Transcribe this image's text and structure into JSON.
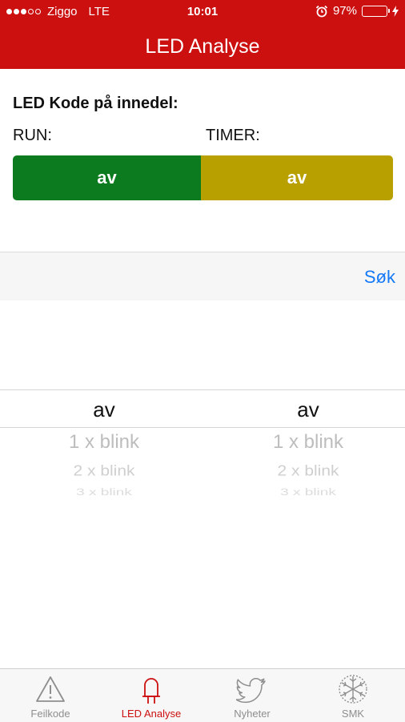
{
  "status_bar": {
    "carrier": "Ziggo",
    "network": "LTE",
    "time": "10:01",
    "battery_text": "97%",
    "battery_level": 0.97,
    "signal_bars_filled": 3,
    "signal_bars_total": 5,
    "icons": [
      "signal-dots-icon",
      "alarm-icon",
      "battery-icon",
      "charging-bolt-icon"
    ]
  },
  "nav": {
    "title": "LED Analyse"
  },
  "led": {
    "heading": "LED Kode på innedel:",
    "run_label": "RUN:",
    "timer_label": "TIMER:",
    "run_value": "av",
    "timer_value": "av",
    "run_color": "#0c7a1e",
    "timer_color": "#b8a000"
  },
  "search": {
    "button_label": "Søk"
  },
  "picker": {
    "left": {
      "selected": "av",
      "options": [
        "1 x blink",
        "2 x blink",
        "3 x blink"
      ]
    },
    "right": {
      "selected": "av",
      "options": [
        "1 x blink",
        "2 x blink",
        "3 x blink"
      ]
    }
  },
  "tabs": [
    {
      "label": "Feilkode",
      "icon": "warning-triangle-icon",
      "active": false
    },
    {
      "label": "LED Analyse",
      "icon": "led-bulb-icon",
      "active": true
    },
    {
      "label": "Nyheter",
      "icon": "twitter-bird-icon",
      "active": false
    },
    {
      "label": "SMK",
      "icon": "snowflake-icon",
      "active": false
    }
  ],
  "colors": {
    "brand_red": "#cc0f0f",
    "link_blue": "#1479f6"
  }
}
